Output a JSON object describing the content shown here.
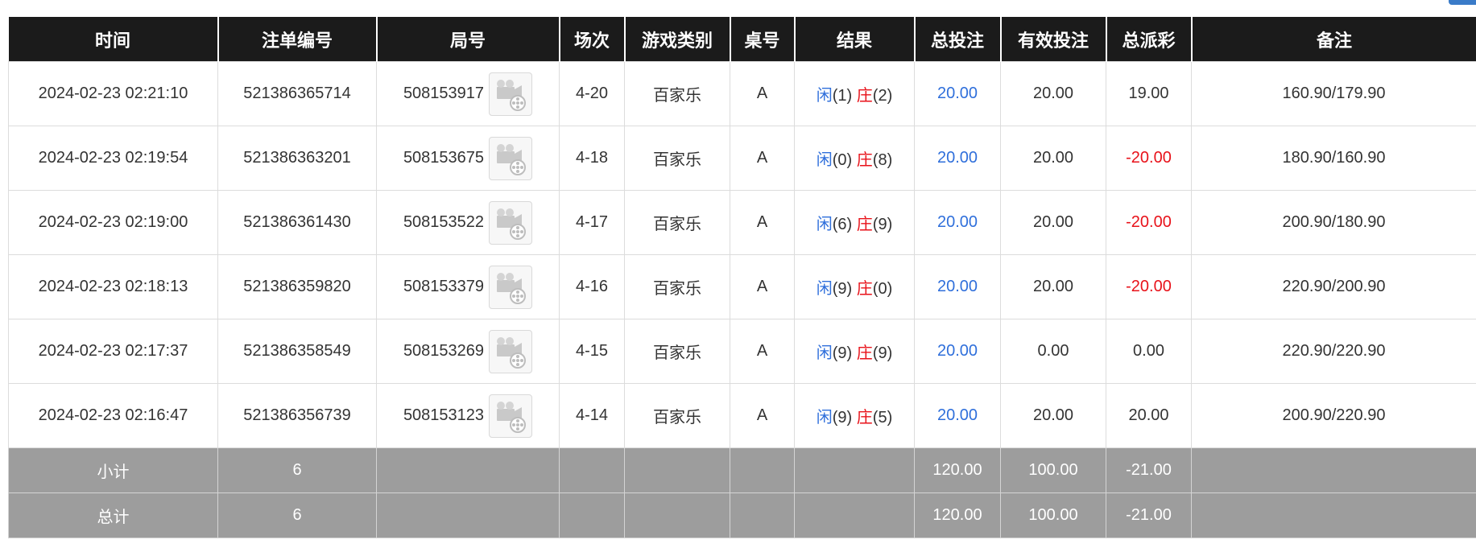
{
  "colors": {
    "header_bg": "#1b1b1b",
    "summary_bg": "#9d9d9d",
    "player_blue": "#2f6fdb",
    "banker_red": "#e8121a",
    "negative_red": "#e8121a"
  },
  "columns": [
    "时间",
    "注单编号",
    "局号",
    "场次",
    "游戏类别",
    "桌号",
    "结果",
    "总投注",
    "有效投注",
    "总派彩",
    "备注"
  ],
  "rows": [
    {
      "time": "2024-02-23 02:21:10",
      "bet_id": "521386365714",
      "round": "508153917",
      "session": "4-20",
      "game": "百家乐",
      "table": "A",
      "player_label": "闲",
      "player_score": "(1)",
      "banker_label": "庄",
      "banker_score": "(2)",
      "total_bet": "20.00",
      "valid_bet": "20.00",
      "payout": "19.00",
      "payout_negative": false,
      "remark": "160.90/179.90",
      "replay_icon": "film-reel-icon"
    },
    {
      "time": "2024-02-23 02:19:54",
      "bet_id": "521386363201",
      "round": "508153675",
      "session": "4-18",
      "game": "百家乐",
      "table": "A",
      "player_label": "闲",
      "player_score": "(0)",
      "banker_label": "庄",
      "banker_score": "(8)",
      "total_bet": "20.00",
      "valid_bet": "20.00",
      "payout": "-20.00",
      "payout_negative": true,
      "remark": "180.90/160.90",
      "replay_icon": "film-reel-icon"
    },
    {
      "time": "2024-02-23 02:19:00",
      "bet_id": "521386361430",
      "round": "508153522",
      "session": "4-17",
      "game": "百家乐",
      "table": "A",
      "player_label": "闲",
      "player_score": "(6)",
      "banker_label": "庄",
      "banker_score": "(9)",
      "total_bet": "20.00",
      "valid_bet": "20.00",
      "payout": "-20.00",
      "payout_negative": true,
      "remark": "200.90/180.90",
      "replay_icon": "film-reel-icon"
    },
    {
      "time": "2024-02-23 02:18:13",
      "bet_id": "521386359820",
      "round": "508153379",
      "session": "4-16",
      "game": "百家乐",
      "table": "A",
      "player_label": "闲",
      "player_score": "(9)",
      "banker_label": "庄",
      "banker_score": "(0)",
      "total_bet": "20.00",
      "valid_bet": "20.00",
      "payout": "-20.00",
      "payout_negative": true,
      "remark": "220.90/200.90",
      "replay_icon": "film-reel-icon"
    },
    {
      "time": "2024-02-23 02:17:37",
      "bet_id": "521386358549",
      "round": "508153269",
      "session": "4-15",
      "game": "百家乐",
      "table": "A",
      "player_label": "闲",
      "player_score": "(9)",
      "banker_label": "庄",
      "banker_score": "(9)",
      "total_bet": "20.00",
      "valid_bet": "0.00",
      "payout": "0.00",
      "payout_negative": false,
      "remark": "220.90/220.90",
      "replay_icon": "film-reel-icon"
    },
    {
      "time": "2024-02-23 02:16:47",
      "bet_id": "521386356739",
      "round": "508153123",
      "session": "4-14",
      "game": "百家乐",
      "table": "A",
      "player_label": "闲",
      "player_score": "(9)",
      "banker_label": "庄",
      "banker_score": "(5)",
      "total_bet": "20.00",
      "valid_bet": "20.00",
      "payout": "20.00",
      "payout_negative": false,
      "remark": "200.90/220.90",
      "replay_icon": "film-reel-icon"
    }
  ],
  "subtotal": {
    "label": "小计",
    "count": "6",
    "total_bet": "120.00",
    "valid_bet": "100.00",
    "payout": "-21.00"
  },
  "total": {
    "label": "总计",
    "count": "6",
    "total_bet": "120.00",
    "valid_bet": "100.00",
    "payout": "-21.00"
  }
}
